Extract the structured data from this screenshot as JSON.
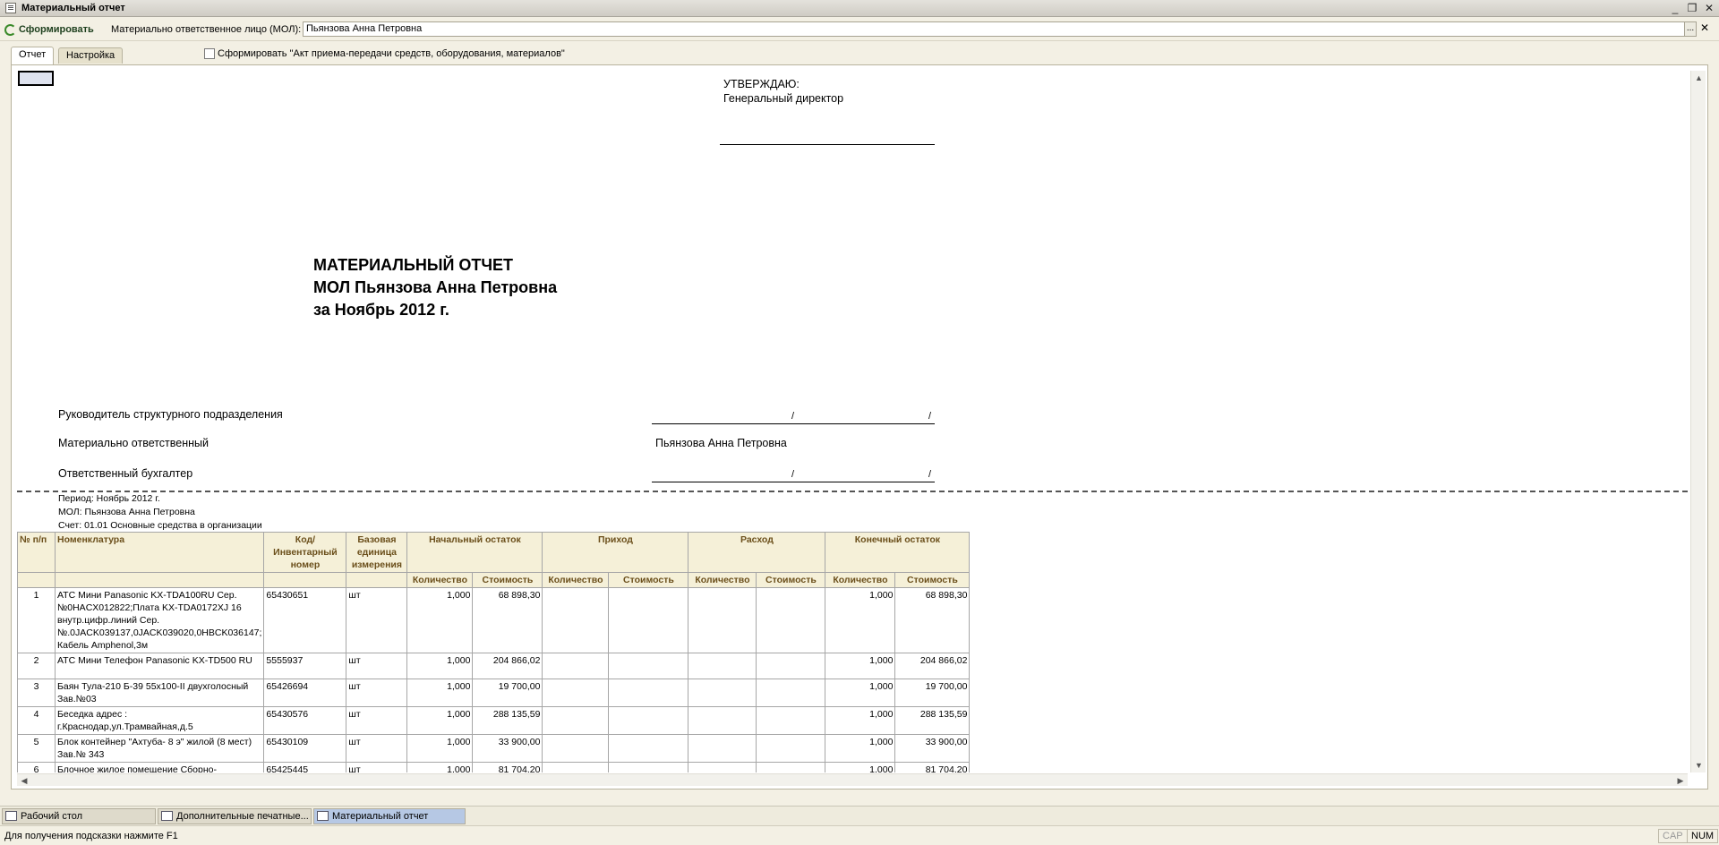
{
  "window": {
    "title": "Материальный отчет",
    "controls": {
      "minimize": "_",
      "restore": "❐",
      "close": "✕"
    }
  },
  "toolbar": {
    "form_button": "Сформировать",
    "mol_label": "Материально ответственное лицо (МОЛ):",
    "mol_value": "Пьянзова Анна Петровна",
    "dots": "...",
    "clear": "✕"
  },
  "tabs": [
    {
      "label": "Отчет",
      "active": true
    },
    {
      "label": "Настройка",
      "active": false
    }
  ],
  "akt_checkbox": {
    "label": "Сформировать \"Акт приема-передачи средств, оборудования, материалов\"",
    "checked": false
  },
  "report": {
    "approve": "УТВЕРЖДАЮ:",
    "director": "Генеральный директор",
    "title_lines": [
      "МАТЕРИАЛЬНЫЙ ОТЧЕТ",
      "МОЛ Пьянзова Анна Петровна",
      "за Ноябрь 2012 г."
    ],
    "sign_head": "Руководитель структурного подразделения",
    "sign_mol": "Материально ответственный",
    "sign_mol_name": "Пьянзова Анна Петровна",
    "sign_acc": "Ответственный бухгалтер",
    "slash": "/",
    "period": "Период: Ноябрь 2012 г.",
    "mol": "МОЛ: Пьянзова Анна Петровна",
    "account": "Счет: 01.01  Основные средства в организации"
  },
  "table": {
    "headers": {
      "num": "№ п/п",
      "nom": "Номенклатура",
      "code": "Код/ Инвентарный номер",
      "unit": "Базовая единица измерения",
      "start": "Начальный остаток",
      "income": "Приход",
      "expense": "Расход",
      "end": "Конечный остаток",
      "qty": "Количество",
      "cost": "Стоимость"
    },
    "rows": [
      {
        "n": "1",
        "name": "АТС Мини Panasonic  KX-TDA100RU Сер.№0HACX012822;Плата KX-TDA0172XJ 16 внутр.цифр.линий Сер.№.0JACK039137,0JACK039020,0HBCK036147; Кабель Amphenol,3м",
        "code": "65430651",
        "unit": "шт",
        "sq": "1,000",
        "sc": "68 898,30",
        "eq": "1,000",
        "ec": "68 898,30"
      },
      {
        "n": "2",
        "name": "АТС Мини Телефон Panasonic KX-TD500 RU",
        "code": " 5555937",
        "unit": "шт",
        "sq": "1,000",
        "sc": "204 866,02",
        "eq": "1,000",
        "ec": "204 866,02"
      },
      {
        "n": "3",
        "name": "Баян Тула-210 Б-39 55х100-II двухголосный Зав.№03",
        "code": "65426694",
        "unit": "шт",
        "sq": "1,000",
        "sc": "19 700,00",
        "eq": "1,000",
        "ec": "19 700,00"
      },
      {
        "n": "4",
        "name": "Беседка адрес : г.Краснодар,ул.Трамвайная,д.5",
        "code": "65430576",
        "unit": "шт",
        "sq": "1,000",
        "sc": "288 135,59",
        "eq": "1,000",
        "ec": "288 135,59"
      },
      {
        "n": "5",
        "name": "Блок контейнер \"Ахтуба- 8 э\" жилой (8 мест) Зав.№ 343",
        "code": "65430109",
        "unit": "шт",
        "sq": "1,000",
        "sc": "33 900,00",
        "eq": "1,000",
        "ec": "33 900,00"
      },
      {
        "n": "6",
        "name": "Блочное жилое помещение Сборно-разборное сооружение",
        "code": "65425445",
        "unit": "шт",
        "sq": "1,000",
        "sc": "81 704,20",
        "eq": "1,000",
        "ec": "81 704,20"
      }
    ]
  },
  "taskbar": [
    {
      "label": "Рабочий стол",
      "active": false
    },
    {
      "label": "Дополнительные печатные...",
      "active": false
    },
    {
      "label": "Материальный отчет",
      "active": true
    }
  ],
  "status": {
    "hint": "Для получения подсказки нажмите F1",
    "cap": "CAP",
    "num": "NUM"
  }
}
